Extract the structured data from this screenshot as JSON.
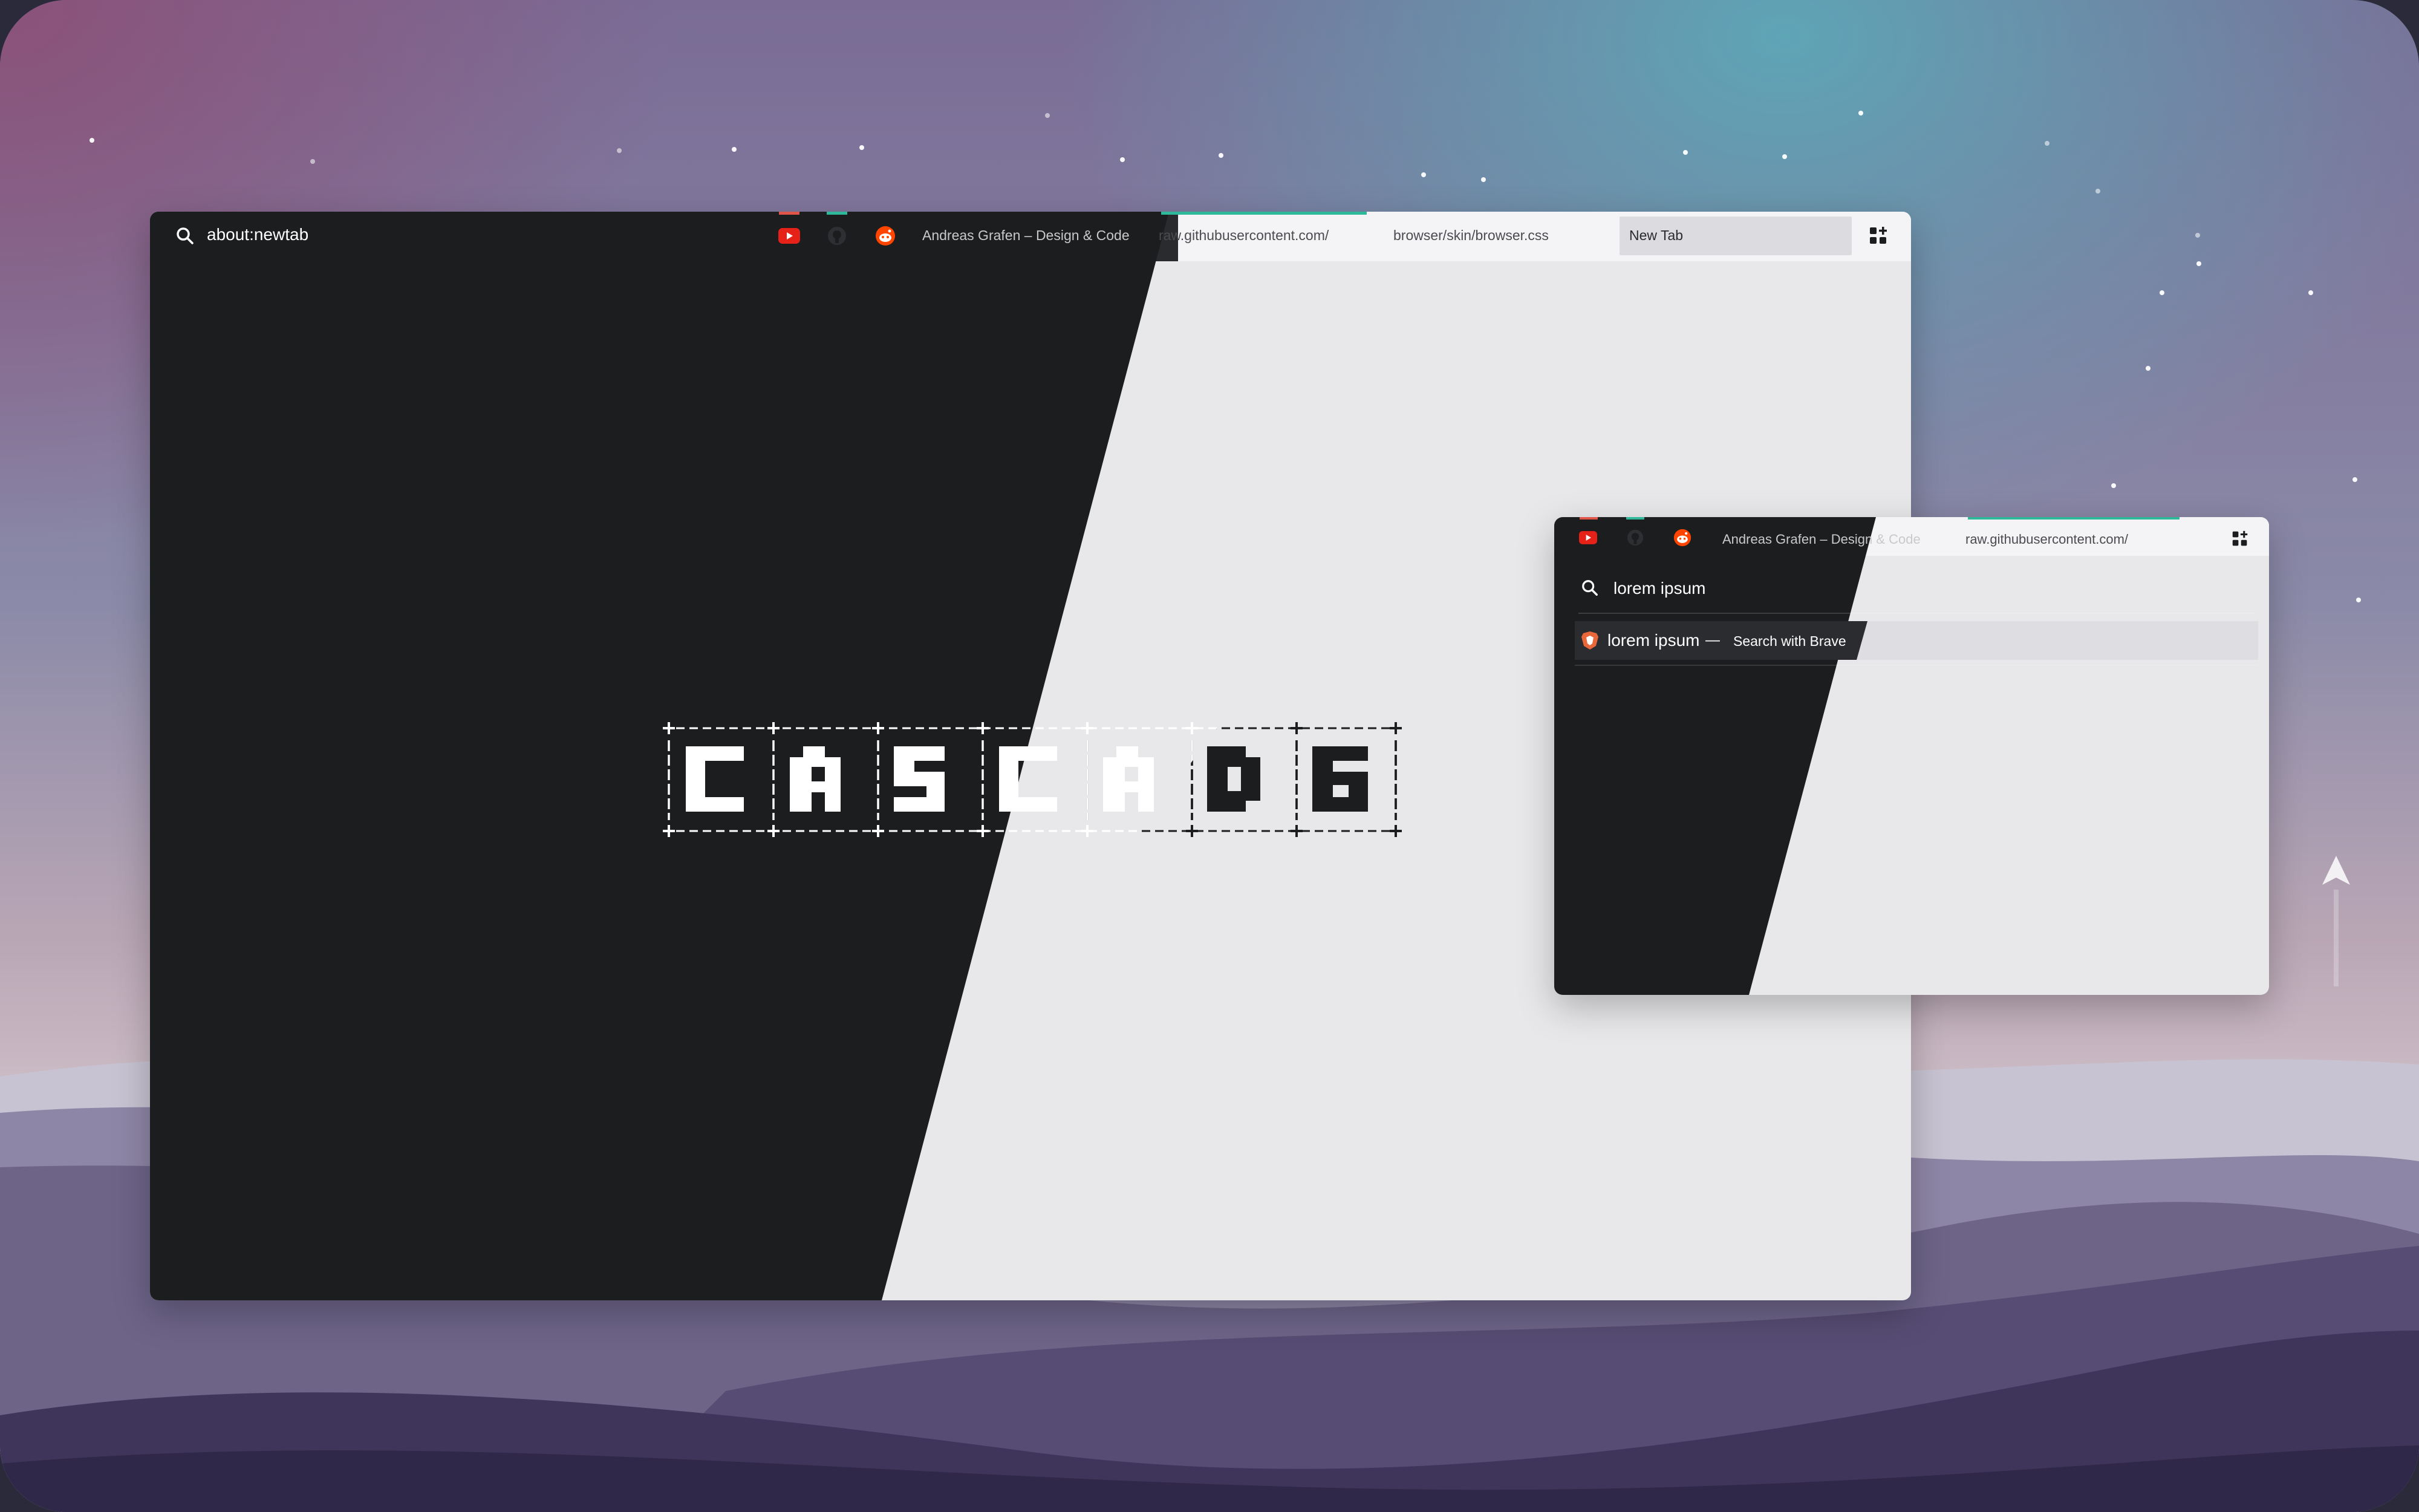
{
  "main_window": {
    "url_bar": {
      "value": "about:newtab"
    },
    "tabs": [
      {
        "label": "",
        "icon": "youtube-icon",
        "indicator_color": "#e0554a"
      },
      {
        "label": "",
        "icon": "github-icon",
        "indicator_color": "#2fb89a"
      },
      {
        "label": "",
        "icon": "reddit-icon"
      },
      {
        "label": "Andreas Grafen – Design & Code"
      },
      {
        "label": "raw.githubusercontent.com/",
        "indicator_color": "#2fb89a"
      },
      {
        "label": "browser/skin/browser.css"
      },
      {
        "label": "New Tab",
        "active": true
      }
    ],
    "new_tab_icon": "add-tab-grid-icon",
    "logo_text": "CASCADE"
  },
  "small_window": {
    "tabs": [
      {
        "label": "",
        "icon": "youtube-icon",
        "indicator_color": "#e0554a"
      },
      {
        "label": "",
        "icon": "github-icon",
        "indicator_color": "#2fb89a"
      },
      {
        "label": "",
        "icon": "reddit-icon"
      },
      {
        "label": "Andreas Grafen – Design & Code"
      },
      {
        "label": "raw.githubusercontent.com/",
        "indicator_color": "#2fb89a"
      }
    ],
    "new_tab_icon": "add-tab-grid-icon",
    "search": {
      "value": "lorem ipsum"
    },
    "suggestion": {
      "query": "lorem ipsum",
      "separator": "—",
      "action": "Search with Brave",
      "icon": "brave-icon"
    }
  },
  "colors": {
    "dark": "#1c1d1f",
    "light": "#e8e8eb",
    "accent": "#2fb89a",
    "youtube": "#e62117",
    "reddit": "#ff4500"
  }
}
